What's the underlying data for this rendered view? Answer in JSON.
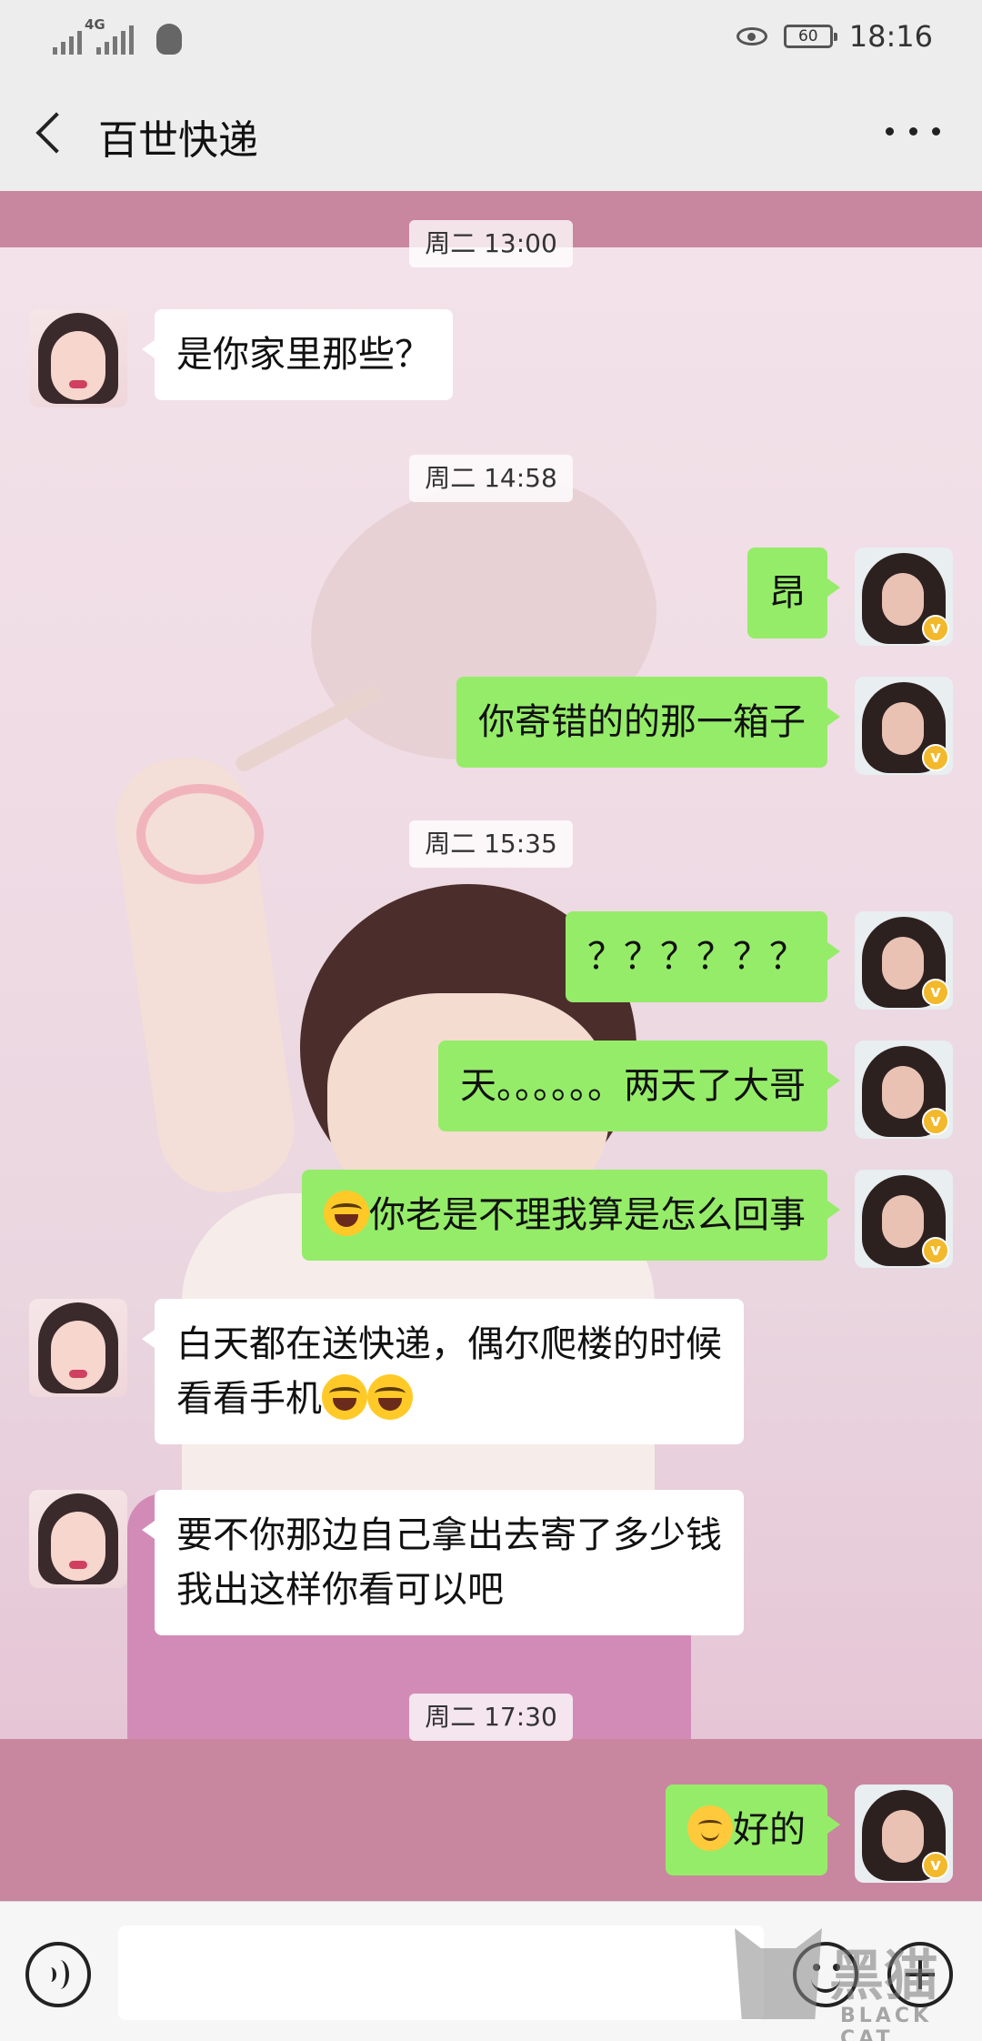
{
  "status_bar": {
    "network_label": "4G",
    "battery": "60",
    "time": "18:16",
    "icons": [
      "no-sim-signal-icon",
      "cellular-signal-icon",
      "qq-icon",
      "eye-comfort-icon",
      "battery-icon"
    ]
  },
  "header": {
    "title": "百世快递",
    "back_icon": "back-arrow-icon",
    "more_icon": "more-dots-icon"
  },
  "messages": [
    {
      "type": "time",
      "text": "周二 13:00"
    },
    {
      "type": "msg",
      "side": "in",
      "text": "是你家里那些？"
    },
    {
      "type": "time",
      "text": "周二 14:58"
    },
    {
      "type": "msg",
      "side": "out",
      "text": "昂"
    },
    {
      "type": "msg",
      "side": "out",
      "text": "你寄错的的那一箱子"
    },
    {
      "type": "time",
      "text": "周二 15:35"
    },
    {
      "type": "msg",
      "side": "out",
      "text": "？？？？？？"
    },
    {
      "type": "msg",
      "side": "out",
      "text": "天。。。。。。两天了大哥"
    },
    {
      "type": "msg",
      "side": "out",
      "text": "你老是不理我算是怎么回事",
      "emoji_before": "tears-of-joy-emoji"
    },
    {
      "type": "msg",
      "side": "in",
      "line1": "白天都在送快递，偶尔爬楼的时候",
      "line2": "看看手机",
      "emoji_after": [
        "tears-of-joy-emoji",
        "tears-of-joy-emoji"
      ]
    },
    {
      "type": "msg",
      "side": "in",
      "line1": "要不你那边自己拿出去寄了多少钱",
      "line2": "我出这样你看可以吧"
    },
    {
      "type": "time",
      "text": "周二 17:30"
    },
    {
      "type": "msg",
      "side": "out",
      "text": "好的",
      "emoji_before": "smile-emoji"
    }
  ],
  "input_bar": {
    "value": "",
    "icons": [
      "voice-icon",
      "emoji-icon",
      "plus-icon"
    ]
  },
  "watermark": {
    "text_cn": "黑猫",
    "text_en": "BLACK CAT"
  },
  "colors": {
    "outgoing_bubble": "#95ec69",
    "incoming_bubble": "#ffffff",
    "chat_background": "#c9869f",
    "app_bar": "#ededed",
    "verified_badge": "#f2b92c"
  }
}
